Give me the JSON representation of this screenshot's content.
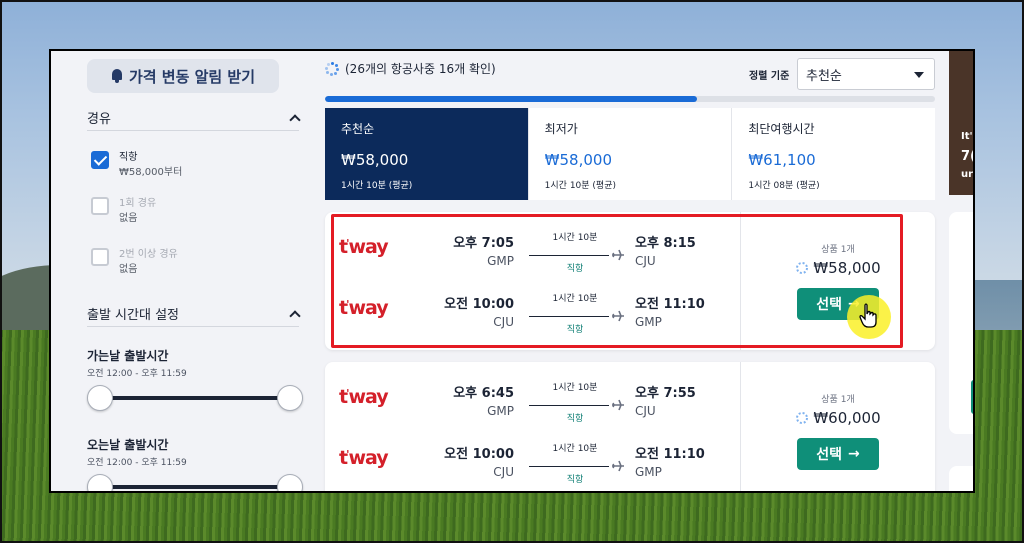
{
  "price_alert": {
    "label": "가격 변동 알림 받기"
  },
  "filters": {
    "stops": {
      "title": "경유",
      "options": [
        {
          "label": "직항",
          "sub": "₩58,000부터",
          "checked": true
        },
        {
          "label": "1회 경유",
          "sub": "없음",
          "checked": false
        },
        {
          "label": "2번 이상 경유",
          "sub": "없음",
          "checked": false
        }
      ]
    },
    "departure_time": {
      "title": "출발 시간대 설정",
      "outbound": {
        "label": "가는날 출발시간",
        "range": "오전 12:00 - 오후 11:59"
      },
      "inbound": {
        "label": "오는날 출발시간",
        "range": "오전 12:00 - 오후 11:59"
      }
    }
  },
  "search_status": "(26개의 항공사중 16개 확인)",
  "search_progress": 0.61,
  "sort": {
    "label": "정렬 기준",
    "value": "추천순"
  },
  "sort_tabs": [
    {
      "name": "추천순",
      "price": "₩58,000",
      "duration": "1시간 10분 (평균)",
      "active": true
    },
    {
      "name": "최저가",
      "price": "₩58,000",
      "duration": "1시간 10분 (평균)",
      "active": false
    },
    {
      "name": "최단여행시간",
      "price": "₩61,100",
      "duration": "1시간 08분 (평균)",
      "active": false
    }
  ],
  "results": [
    {
      "legs": [
        {
          "airline": "t'way",
          "dep_time": "오후 7:05",
          "dep_code": "GMP",
          "duration": "1시간 10분",
          "type": "직항",
          "arr_time": "오후 8:15",
          "arr_code": "CJU"
        },
        {
          "airline": "t'way",
          "dep_time": "오전 10:00",
          "dep_code": "CJU",
          "duration": "1시간 10분",
          "type": "직항",
          "arr_time": "오전 11:10",
          "arr_code": "GMP"
        }
      ],
      "offer_count": "상품 1개",
      "price": "₩58,000",
      "select_label": "선택"
    },
    {
      "legs": [
        {
          "airline": "t'way",
          "dep_time": "오후 6:45",
          "dep_code": "GMP",
          "duration": "1시간 10분",
          "type": "직항",
          "arr_time": "오후 7:55",
          "arr_code": "CJU"
        },
        {
          "airline": "t'way",
          "dep_time": "오전 10:00",
          "dep_code": "CJU",
          "duration": "1시간 10분",
          "type": "직항",
          "arr_time": "오전 11:10",
          "arr_code": "GMP"
        }
      ],
      "offer_count": "상품 1개",
      "price": "₩60,000",
      "select_label": "선택"
    }
  ],
  "side_ad": {
    "line1": "It'",
    "line2": "7(",
    "line3": "ur"
  },
  "colors": {
    "accent": "#1a6bd6",
    "active_tab": "#0c2a5b",
    "select_button": "#0f8f79",
    "airline_logo": "#d4202a",
    "highlight": "#e41b23"
  }
}
